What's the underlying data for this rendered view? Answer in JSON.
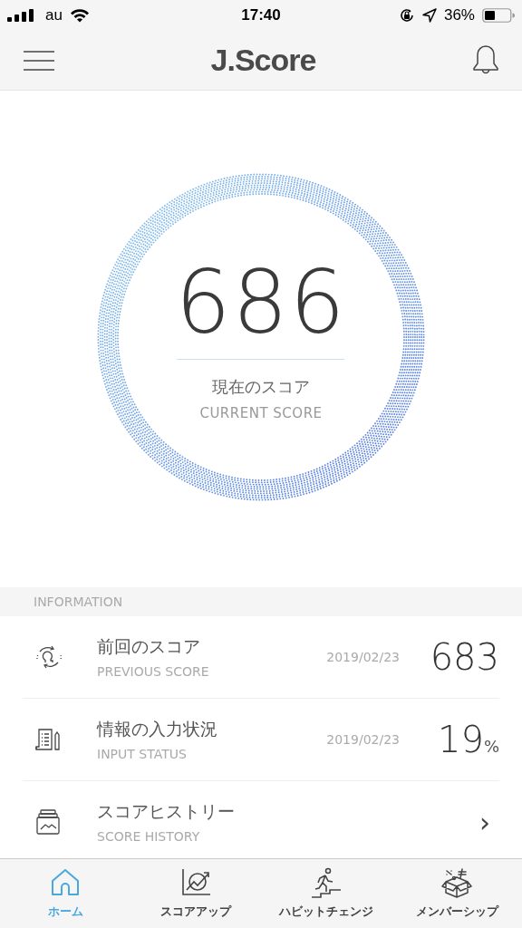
{
  "status_bar": {
    "carrier": "au",
    "time": "17:40",
    "battery": "36%"
  },
  "header": {
    "title": "J.Score"
  },
  "current_score": {
    "value": "686",
    "label": "現在のスコア",
    "sublabel": "CURRENT SCORE"
  },
  "information": {
    "title": "INFORMATION",
    "items": [
      {
        "kind": "score",
        "title": "前回のスコア",
        "subtitle": "PREVIOUS SCORE",
        "date": "2019/02/23",
        "value": "683"
      },
      {
        "kind": "status",
        "title": "情報の入力状況",
        "subtitle": "INPUT STATUS",
        "date": "2019/02/23",
        "value": "19",
        "unit": "%"
      },
      {
        "kind": "link",
        "title": "スコアヒストリー",
        "subtitle": "SCORE HISTORY",
        "arrow": "›"
      }
    ]
  },
  "tabs": [
    {
      "label": "ホーム",
      "selected": true
    },
    {
      "label": "スコアアップ",
      "selected": false
    },
    {
      "label": "ハビットチェンジ",
      "selected": false
    },
    {
      "label": "メンバーシップ",
      "selected": false
    }
  ]
}
